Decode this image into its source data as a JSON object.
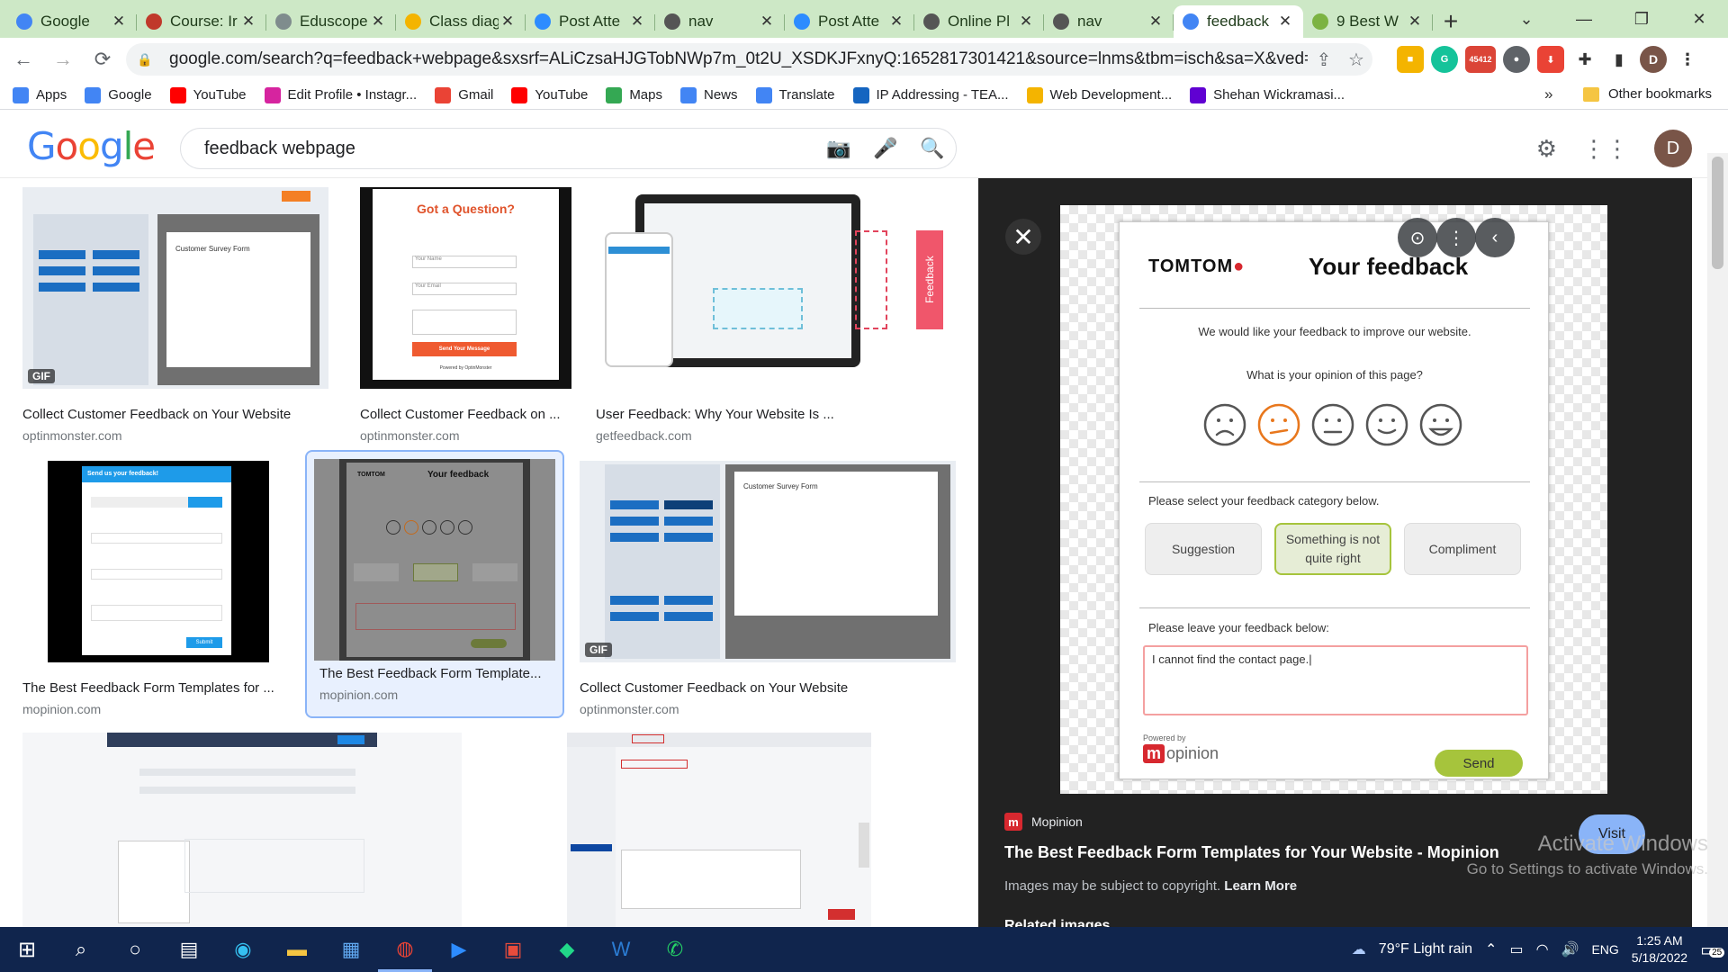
{
  "tabs": [
    {
      "label": "Google",
      "fav": "#4285f4",
      "icon": "google-icon"
    },
    {
      "label": "Course: Ir",
      "fav": "#c0392b",
      "icon": "course-icon"
    },
    {
      "label": "Eduscope",
      "fav": "#7f8c8d",
      "icon": "eduscope-icon"
    },
    {
      "label": "Class diag",
      "fav": "#f4b400",
      "icon": "drive-icon"
    },
    {
      "label": "Post Atte",
      "fav": "#2d8cff",
      "icon": "zoom-icon"
    },
    {
      "label": "nav",
      "fav": "#555555",
      "icon": "globe-icon"
    },
    {
      "label": "Post Atte",
      "fav": "#2d8cff",
      "icon": "zoom-icon"
    },
    {
      "label": "Online Pl",
      "fav": "#555555",
      "icon": "globe-icon"
    },
    {
      "label": "nav",
      "fav": "#555555",
      "icon": "globe-icon"
    },
    {
      "label": "feedback",
      "fav": "#4285f4",
      "icon": "google-icon",
      "active": true
    },
    {
      "label": "9 Best W",
      "fav": "#7cb342",
      "icon": "site-icon"
    }
  ],
  "address": {
    "url": "google.com/search?q=feedback+webpage&sxsrf=ALiCzsaHJGTobNWp7m_0t2U_XSDKJFxnyQ:1652817301421&source=lnms&tbm=isch&sa=X&ved=2ahUKEwjN2o..."
  },
  "ext_badge": "45412",
  "profile_initial": "D",
  "bookmarks": [
    {
      "label": "Apps",
      "color": "#4285f4"
    },
    {
      "label": "Google",
      "color": "#4285f4"
    },
    {
      "label": "YouTube",
      "color": "#ff0000"
    },
    {
      "label": "Edit Profile • Instagr...",
      "color": "#d6249f"
    },
    {
      "label": "Gmail",
      "color": "#ea4335"
    },
    {
      "label": "YouTube",
      "color": "#ff0000"
    },
    {
      "label": "Maps",
      "color": "#34a853"
    },
    {
      "label": "News",
      "color": "#4285f4"
    },
    {
      "label": "Translate",
      "color": "#4285f4"
    },
    {
      "label": "IP Addressing - TEA...",
      "color": "#1565c0"
    },
    {
      "label": "Web Development...",
      "color": "#f4b400"
    },
    {
      "label": "Shehan Wickramasi...",
      "color": "#6001d2"
    }
  ],
  "bookmarks_overflow": "»",
  "other_bookmarks": "Other bookmarks",
  "google": {
    "logo": "Google",
    "query": "feedback webpage",
    "avatar": "D"
  },
  "results": [
    {
      "title": "Collect Customer Feedback on Your Website",
      "source": "optinmonster.com",
      "gif": "GIF",
      "selected": false
    },
    {
      "title": "Collect Customer Feedback on ...",
      "source": "optinmonster.com",
      "gif": "",
      "selected": false
    },
    {
      "title": "User Feedback: Why Your Website Is ...",
      "source": "getfeedback.com",
      "gif": "",
      "selected": false
    },
    {
      "title": "The Best Feedback Form Templates for ...",
      "source": "mopinion.com",
      "gif": "",
      "selected": false
    },
    {
      "title": "The Best Feedback Form Template...",
      "source": "mopinion.com",
      "gif": "",
      "selected": true
    },
    {
      "title": "Collect Customer Feedback on Your Website",
      "source": "optinmonster.com",
      "gif": "GIF",
      "selected": false
    }
  ],
  "thumb_text": {
    "got_question": "Got a Question?",
    "send_message": "Send Your Message",
    "powered": "Powered by OptinMonster",
    "your_name": "Your Name",
    "your_email": "Your Email",
    "feedback_tab": "Feedback",
    "send_us": "Send us your feedback!",
    "customer_survey": "Customer Survey Form",
    "submit": "Submit"
  },
  "preview": {
    "form": {
      "brand": "TOMTOM",
      "title": "Your feedback",
      "intro": "We would like your feedback to improve our website.",
      "question": "What is your opinion of this page?",
      "category_label": "Please select your feedback category below.",
      "categories": [
        "Suggestion",
        "Something is not quite right",
        "Compliment"
      ],
      "selected_category": 1,
      "selected_face": 1,
      "feedback_label": "Please leave your feedback below:",
      "feedback_text": "I cannot find the contact page.",
      "powered_by": "Powered by",
      "mopinion": "opinion",
      "send": "Send"
    },
    "site": "Mopinion",
    "title": "The Best Feedback Form Templates for Your Website - Mopinion",
    "copyright": "Images may be subject to copyright.",
    "learn_more": "Learn More",
    "visit": "Visit",
    "related": "Related images"
  },
  "activate": {
    "line1": "Activate Windows",
    "line2": "Go to Settings to activate Windows."
  },
  "taskbar": {
    "weather": "79°F  Light rain",
    "lang": "ENG",
    "time": "1:25 AM",
    "date": "5/18/2022",
    "notif_count": "25"
  }
}
